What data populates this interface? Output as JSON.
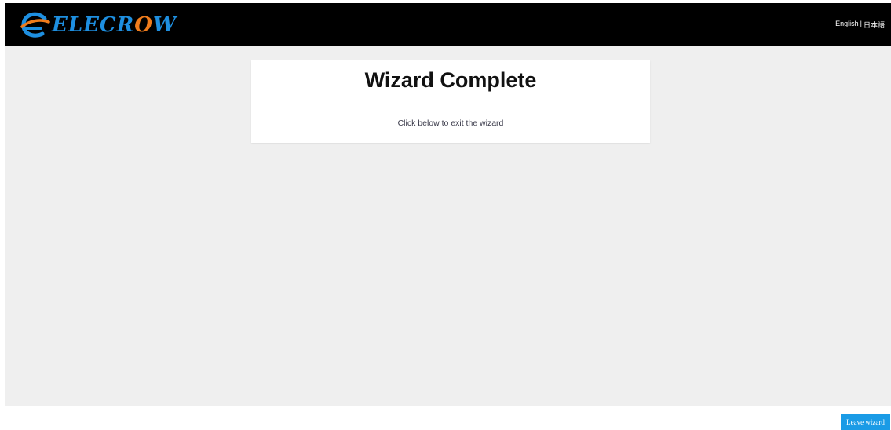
{
  "header": {
    "brand_first": "E",
    "brand_middle": "LECR",
    "brand_accent": "O",
    "brand_last": "W",
    "logo_icon": "elecrow-swirl-icon",
    "lang_english": "English",
    "lang_separator": "|",
    "lang_japanese": "日本語"
  },
  "card": {
    "title": "Wizard Complete",
    "message": "Click below to exit the wizard"
  },
  "footer": {
    "leave_label": "Leave wizard"
  },
  "colors": {
    "topbar": "#000000",
    "page_bg": "#efefef",
    "brand_blue": "#1e8fe0",
    "brand_orange": "#f07c1c",
    "button": "#1a9be6"
  }
}
